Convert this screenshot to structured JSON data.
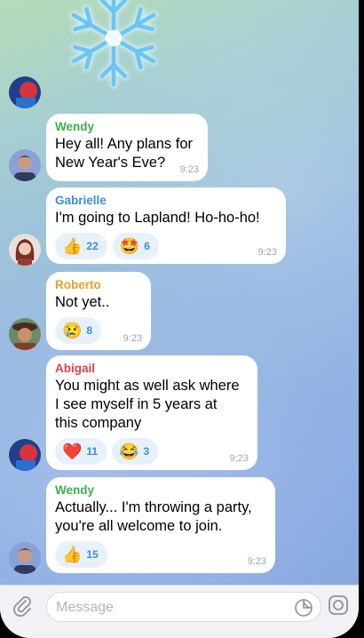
{
  "messages": [
    {
      "sender": "Wendy",
      "sender_color": "#3cb04a",
      "text": "Hey all! Any plans for\nNew Year's Eve?",
      "time": "9:23",
      "reactions": []
    },
    {
      "sender": "Gabrielle",
      "sender_color": "#3c8fd6",
      "text": "I'm going to Lapland! Ho-ho-ho!",
      "time": "9:23",
      "reactions": [
        {
          "emoji": "👍",
          "count": "22"
        },
        {
          "emoji": "🤩",
          "count": "6"
        }
      ]
    },
    {
      "sender": "Roberto",
      "sender_color": "#e6a224",
      "text": "Not yet..",
      "time": "9:23",
      "reactions": [
        {
          "emoji": "😢",
          "count": "8"
        }
      ]
    },
    {
      "sender": "Abigail",
      "sender_color": "#d9434a",
      "text": "You might as well ask where\nI see myself in 5 years at\nthis company",
      "time": "9:23",
      "reactions": [
        {
          "emoji": "❤️",
          "count": "11"
        },
        {
          "emoji": "😂",
          "count": "3"
        }
      ]
    },
    {
      "sender": "Wendy",
      "sender_color": "#3cb04a",
      "text": "Actually... I'm throwing a party,\nyou're all welcome to join.",
      "time": "9:23",
      "reactions": [
        {
          "emoji": "👍",
          "count": "15"
        }
      ]
    }
  ],
  "composer": {
    "placeholder": "Message"
  },
  "icons": [
    "snowflake-icon",
    "attach-icon",
    "sticker-icon",
    "camera-icon"
  ]
}
